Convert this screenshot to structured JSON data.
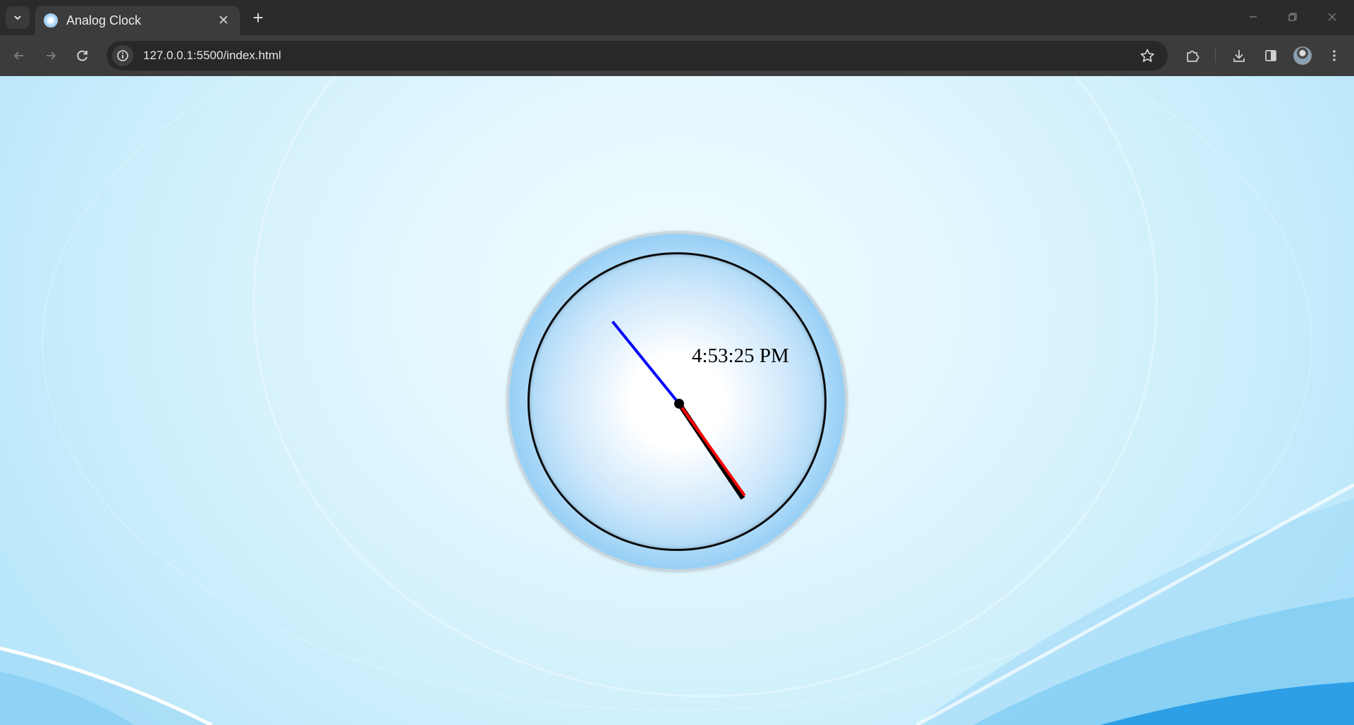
{
  "browser": {
    "tab_title": "Analog Clock",
    "tab_close_glyph": "✕",
    "new_tab_glyph": "+",
    "url": "127.0.0.1:5500/index.html"
  },
  "window_controls": {
    "minimize": "—",
    "restore": "❐",
    "close": "✕"
  },
  "clock": {
    "digital_time": "4:53:25 PM",
    "hour": 4,
    "minute": 53,
    "second": 25,
    "hand_colors": {
      "hour": "#000000",
      "minute": "#ff0000",
      "second": "#0000ff"
    }
  }
}
